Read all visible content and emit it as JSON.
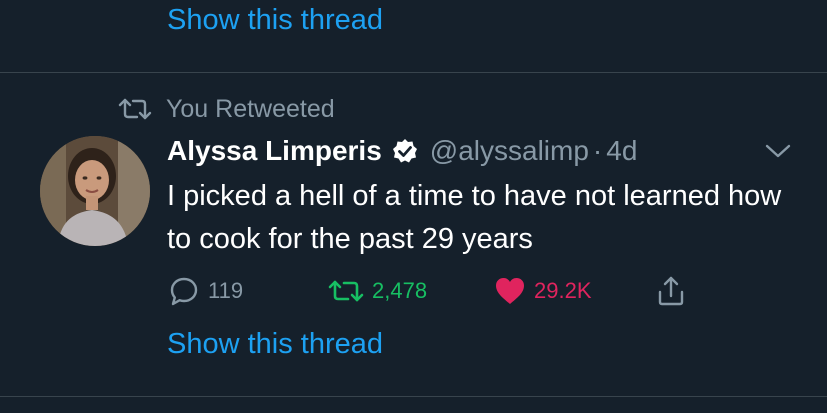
{
  "thread_links": {
    "top": "Show this thread",
    "bottom": "Show this thread"
  },
  "social_context": {
    "icon": "retweet-icon",
    "text": "You Retweeted"
  },
  "tweet": {
    "author": {
      "display_name": "Alyssa Limperis",
      "verified": true,
      "handle": "@alyssalimp",
      "avatar": "profile-photo"
    },
    "separator": "·",
    "timestamp": "4d",
    "text": "I picked a hell of a time to have not learned how to cook for the past 29 years",
    "actions": {
      "reply_count": "119",
      "retweet_count": "2,478",
      "like_count": "29.2K",
      "retweeted": true,
      "liked": true
    }
  },
  "colors": {
    "background": "#15202b",
    "divider": "#38444d",
    "link": "#1da1f2",
    "secondary_text": "#8899a6",
    "retweet_active": "#17bf63",
    "like_active": "#e0245e"
  }
}
